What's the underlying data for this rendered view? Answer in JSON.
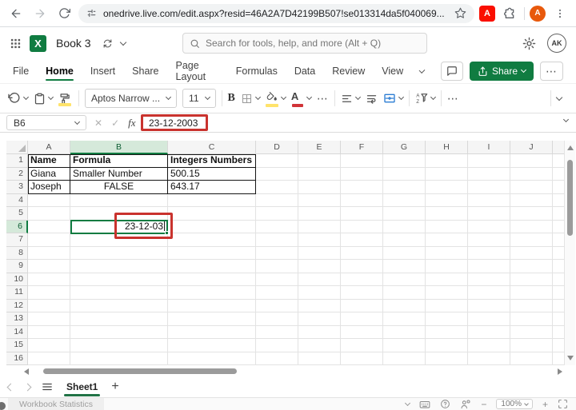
{
  "browser": {
    "url": "onedrive.live.com/edit.aspx?resid=46A2A7D42199B507!se013314da5f040069...",
    "profile_initial": "A"
  },
  "app_header": {
    "workbook_title": "Book 3",
    "search_placeholder": "Search for tools, help, and more (Alt + Q)",
    "profile_initials": "AK"
  },
  "ribbon": {
    "tabs": [
      "File",
      "Home",
      "Insert",
      "Share",
      "Page Layout",
      "Formulas",
      "Data",
      "Review",
      "View"
    ],
    "active_tab": "Home",
    "share_button": "Share"
  },
  "toolbar": {
    "font_name": "Aptos Narrow ...",
    "font_size": "11"
  },
  "formula_bar": {
    "cell_reference": "B6",
    "formula_value": "23-12-2003"
  },
  "glyphs": {
    "bold": "B",
    "ellipsis": "⋯",
    "cancel": "✕",
    "confirm": "✓",
    "fx": "fx",
    "font_color_letter": "A",
    "minus": "−",
    "plus": "+",
    "add_sheet": "+"
  },
  "grid": {
    "column_headers": [
      "A",
      "B",
      "C",
      "D",
      "E",
      "F",
      "G",
      "H",
      "I",
      "J"
    ],
    "row_headers": [
      "1",
      "2",
      "3",
      "4",
      "5",
      "6",
      "7",
      "8",
      "9",
      "10",
      "11",
      "12",
      "13",
      "14",
      "15",
      "16"
    ],
    "selected_column": "B",
    "selected_row": "6",
    "cells": [
      {
        "ref": "A1",
        "value": "Name",
        "bold": true,
        "table": true
      },
      {
        "ref": "B1",
        "value": "Formula",
        "bold": true,
        "table": true
      },
      {
        "ref": "C1",
        "value": "Integers Numbers",
        "bold": true,
        "table": true
      },
      {
        "ref": "A2",
        "value": "Giana",
        "table": true
      },
      {
        "ref": "B2",
        "value": "Smaller Number",
        "table": true
      },
      {
        "ref": "C2",
        "value": "500.15",
        "table": true
      },
      {
        "ref": "A3",
        "value": "Joseph",
        "table": true
      },
      {
        "ref": "B3",
        "value": "FALSE",
        "align": "center",
        "table": true
      },
      {
        "ref": "C3",
        "value": "643.17",
        "table": true
      },
      {
        "ref": "B6",
        "value": "23-12-03",
        "align": "right",
        "caret": true,
        "selected": true
      }
    ]
  },
  "sheet_bar": {
    "active_sheet": "Sheet1"
  },
  "status_bar": {
    "left_label": "Workbook Statistics",
    "zoom_level": "100%"
  },
  "colors": {
    "excel_green": "#107c41",
    "annotation_red": "#c9332e",
    "selected_header_fill": "#d5e9da"
  }
}
